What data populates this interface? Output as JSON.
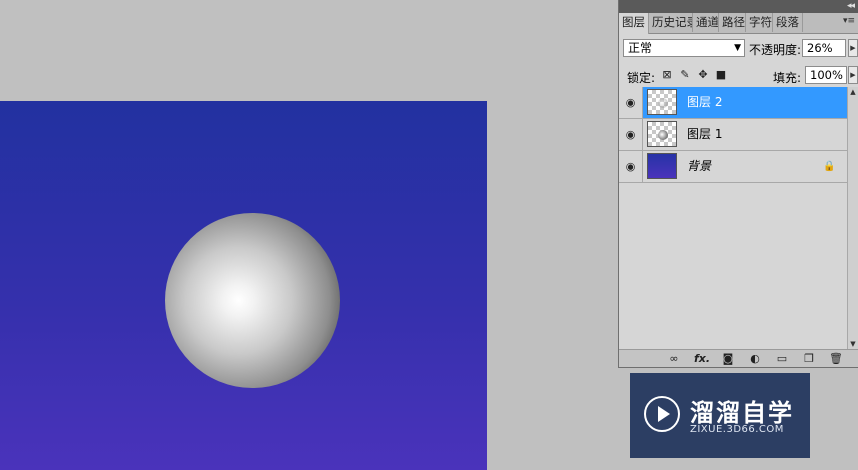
{
  "panel": {
    "collapse_glyph": "◂◂",
    "tabs": [
      "图层",
      "历史记录",
      "通道",
      "路径",
      "字符",
      "段落"
    ],
    "tab_menu_glyph": "▾≡",
    "blend_mode": "正常",
    "opacity_label": "不透明度:",
    "opacity_value": "26%",
    "lock_label": "锁定:",
    "fill_label": "填充:",
    "fill_value": "100%",
    "layers": [
      {
        "name": "图层 2",
        "selected": true
      },
      {
        "name": "图层 1",
        "selected": false
      },
      {
        "name": "背景",
        "selected": false,
        "locked": true
      }
    ],
    "bottom_icons": [
      "link-icon",
      "fx-icon",
      "mask-icon",
      "adjustment-icon",
      "folder-icon",
      "new-layer-icon",
      "trash-icon"
    ],
    "fx_label": "fx."
  },
  "canvas": {
    "background_colors": [
      "#2231a0",
      "#4a33bb"
    ],
    "sphere_colors": [
      "#ffffff",
      "#1e1e1e"
    ]
  },
  "watermark": {
    "title": "溜溜自学",
    "url": "ZIXUE.3D66.COM",
    "background": "#2c3e63"
  },
  "colors": {
    "selection": "#3399ff",
    "workspace": "#c0c0c0",
    "panel": "#d6d6d6"
  }
}
